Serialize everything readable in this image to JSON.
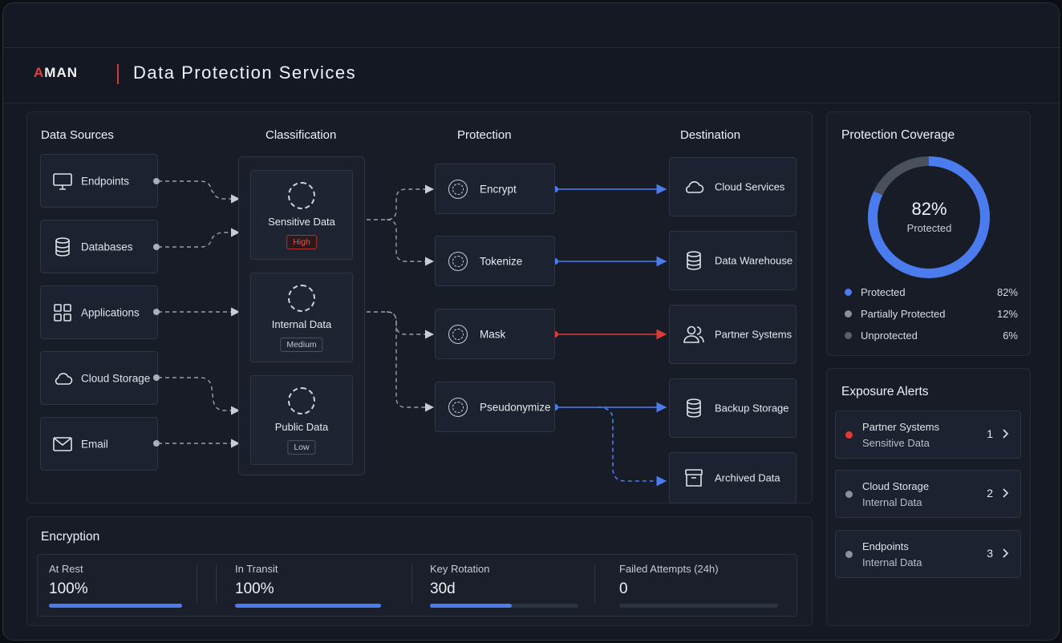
{
  "header": {
    "logo_accent": "A",
    "logo_rest": "MAN",
    "title": "Data Protection Services"
  },
  "colors": {
    "accent_blue": "#4a7cf0",
    "alert_red": "#e03a34",
    "neutral_gray": "#8b919c"
  },
  "flow": {
    "columns": {
      "sources": "Data Sources",
      "classification": "Classification",
      "protection": "Protection",
      "destination": "Destination"
    },
    "sources": [
      {
        "label": "Endpoints",
        "icon": "monitor-icon"
      },
      {
        "label": "Databases",
        "icon": "database-icon"
      },
      {
        "label": "Applications",
        "icon": "grid-icon"
      },
      {
        "label": "Cloud Storage",
        "icon": "cloud-icon"
      },
      {
        "label": "Email",
        "icon": "envelope-icon"
      }
    ],
    "classes": [
      {
        "label": "Sensitive Data",
        "tag": "High"
      },
      {
        "label": "Internal Data",
        "tag": "Medium"
      },
      {
        "label": "Public Data",
        "tag": "Low"
      }
    ],
    "protections": [
      {
        "label": "Encrypt"
      },
      {
        "label": "Tokenize"
      },
      {
        "label": "Mask"
      },
      {
        "label": "Pseudonymize"
      }
    ],
    "destinations": [
      {
        "label": "Cloud Services",
        "icon": "cloud-icon"
      },
      {
        "label": "Data Warehouse",
        "icon": "database-icon"
      },
      {
        "label": "Partner Systems",
        "icon": "users-icon"
      },
      {
        "label": "Backup Storage",
        "icon": "database-icon"
      },
      {
        "label": "Archived Data",
        "icon": "archive-icon"
      }
    ]
  },
  "coverage": {
    "title": "Protection Coverage",
    "percent_label": "82%",
    "sublabel": "Protected",
    "protected_fraction": 0.82,
    "legend": [
      {
        "label": "Protected",
        "value": "82%",
        "color": "#4a7cf0"
      },
      {
        "label": "Partially Protected",
        "value": "12%",
        "color": "#8b919c"
      },
      {
        "label": "Unprotected",
        "value": "6%",
        "color": "#5a606b"
      }
    ]
  },
  "alerts": {
    "title": "Exposure Alerts",
    "items": [
      {
        "line1": "Partner Systems",
        "line2": "Sensitive Data",
        "count": "1",
        "color": "#e03a34"
      },
      {
        "line1": "Cloud Storage",
        "line2": "Internal Data",
        "count": "2",
        "color": "#8b919c"
      },
      {
        "line1": "Endpoints",
        "line2": "Internal Data",
        "count": "3",
        "color": "#8b919c"
      }
    ]
  },
  "encryption": {
    "title": "Encryption",
    "metrics": [
      {
        "label": "At Rest",
        "value": "100%",
        "progress": 1.0
      },
      {
        "label": "In Transit",
        "value": "100%",
        "progress": 1.0
      },
      {
        "label": "Key Rotation",
        "value": "30d",
        "progress": 0.55
      },
      {
        "label": "Failed Attempts (24h)",
        "value": "0",
        "progress": 0
      }
    ]
  }
}
